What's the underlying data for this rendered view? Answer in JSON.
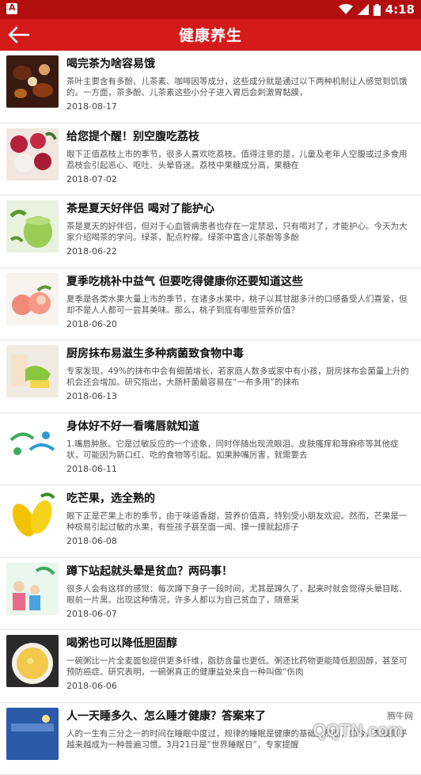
{
  "status_bar": {
    "time": "4:18"
  },
  "app_bar": {
    "title": "健康养生",
    "back_icon": "arrow-left-icon"
  },
  "colors": {
    "status_bar": "#b30e0e",
    "app_bar": "#d41a1a",
    "title_text": "#111111",
    "summary_text": "#555555"
  },
  "articles": [
    {
      "title": "喝完茶为啥容易饿",
      "summary": "茶叶主要含有多酚、儿茶素、咖啡因等成分，这些成分就是通过以下两种机制让人感觉到饥饿的。一方面，茶多酚、儿茶素这些小分子进入胃后会刺激胃黏膜，",
      "date": "2018-08-17",
      "thumb_icon": "tea-cups-image"
    },
    {
      "title": "给您提个醒！别空腹吃荔枝",
      "summary": "眼下正值荔枝上市的季节，很多人喜欢吃荔枝。值得注意的是，儿童及老年人空腹或过多食用荔枝会引起恶心、呕吐、头晕昏迷。荔枝中果糖成分高，果糖在",
      "date": "2018-07-02",
      "thumb_icon": "lychee-image"
    },
    {
      "title": "茶是夏天好伴侣 喝对了能护心",
      "summary": "茶是夏天的好伴侣，但对于心血管病患者也存在一定禁忌，只有喝对了，才能护心。今天为大家介绍喝茶的学问。绿茶，配点柠檬。绿茶中富含儿茶酚等多酚",
      "date": "2018-06-22",
      "thumb_icon": "green-tea-image"
    },
    {
      "title": "夏季吃桃补中益气 但要吃得健康你还要知道这些",
      "summary": "夏季是各类水果大量上市的季节，在诸多水果中，桃子以其甘甜多汁的口感备受人们喜爱，但却不是人人都可一尝其美味。那么，桃子到底有哪些营养价值？",
      "date": "2018-06-20",
      "thumb_icon": "peach-image"
    },
    {
      "title": "厨房抹布易滋生多种病菌致食物中毒",
      "summary": "专家发现，49%的抹布中会有细菌增长，若家庭人数多或家中有小孩，厨房抹布会菌量上升的机会还会增加。研究指出，大肠杆菌最容易在“一布多用”的抹布",
      "date": "2018-06-13",
      "thumb_icon": "kitchen-cloth-image"
    },
    {
      "title": "身体好不好一看嘴唇就知道",
      "summary": "1.嘴唇肿胀。它是过敏反应的一个迹象，同时伴随出现流眼泪、皮肤瘙痒和荨麻疹等其他症状，可能因为新口红、吃的食物等引起。如果肿嘴厉害，就需要去",
      "date": "2018-06-11",
      "thumb_icon": "love-life-logo-image"
    },
    {
      "title": "吃芒果，选全熟的",
      "summary": "眼下正是芒果上市的季节，由于味道香甜，营养价值高，特别受小朋友欢迎。然而，芒果是一种极易引起过敏的水果，有些孩子甚至面一闻、摸一摸就起疹子",
      "date": "2018-06-08",
      "thumb_icon": "mango-image"
    },
    {
      "title": "蹲下站起就头晕是贫血？两码事！",
      "summary": "很多人会有这样的感觉：每次蹲下身子一段时间，尤其是蹲久了，起来时就会觉得头晕目眩、眼前一片黑。出现这种情况，许多人都以为自己贫血了，随意采",
      "date": "2018-06-07",
      "thumb_icon": "family-health-image"
    },
    {
      "title": "喝粥也可以降低胆固醇",
      "summary": "一碗粥比一片全麦面包提供更多纤维，脂肪含量也更低。粥还比药物更能降低胆固醇，甚至可预防癌症。研究表明，一碗粥真正的健康益处来自一种叫做“伤肉",
      "date": "2018-06-06",
      "thumb_icon": "porridge-image"
    },
    {
      "title": "人一天睡多久、怎么睡才健康？答案来了",
      "summary": "人的一生有三分之一的时间在睡眠中度过，规律的睡眠是健康的基础。然而，如今，熬夜似乎越来越成为一种普遍习惯。3月21日是“世界睡眠日”，专家提醒",
      "date": "",
      "thumb_icon": "sleep-book-image"
    }
  ],
  "watermark": {
    "text": "腾牛网",
    "logo": "QQTN.com"
  }
}
